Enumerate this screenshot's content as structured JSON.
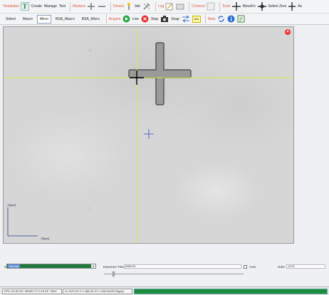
{
  "toolbar1": {
    "templates": "Templates",
    "create": "Create",
    "manage": "Manage",
    "test": "Test",
    "markers": "Markers",
    "device": "Device",
    "link": "link",
    "log": "Log",
    "connect": "Connect",
    "tools": "Tools",
    "movefo": "MoveFo",
    "select_zero": "Select Zero",
    "az": "Az"
  },
  "toolbar2": {
    "tabs": [
      "Select",
      "Macro",
      "Micro",
      "BSA_Macro",
      "BSA_Micro"
    ],
    "active_tab": "Micro",
    "acquire": "Acquire",
    "live": "Live",
    "stop": "Stop",
    "snap": "Snap",
    "aw": "AW",
    "main": "Main"
  },
  "viewer": {
    "scale_y_label": "10[µm]",
    "scale_x_label": "10[µm]"
  },
  "controls": {
    "scale_label": "Scale:",
    "scale_value": "Normal",
    "exposure_label": "Exposure Time:",
    "exposure_value": "6960.00",
    "auto_label": "Auto",
    "gain_label": "Gain:",
    "gain_value": "13.01"
  },
  "status": {
    "fps": "FPS: 20.50 SC: 00000 CT: 0.19 DF: 0000",
    "position": "X=+672.00 Y=+188.00 XY=+169.40/25.00[µm]"
  },
  "colors": {
    "accent_green": "#1e8c3e",
    "crosshair": "#d8e84a",
    "marker": "#3a44c8"
  }
}
